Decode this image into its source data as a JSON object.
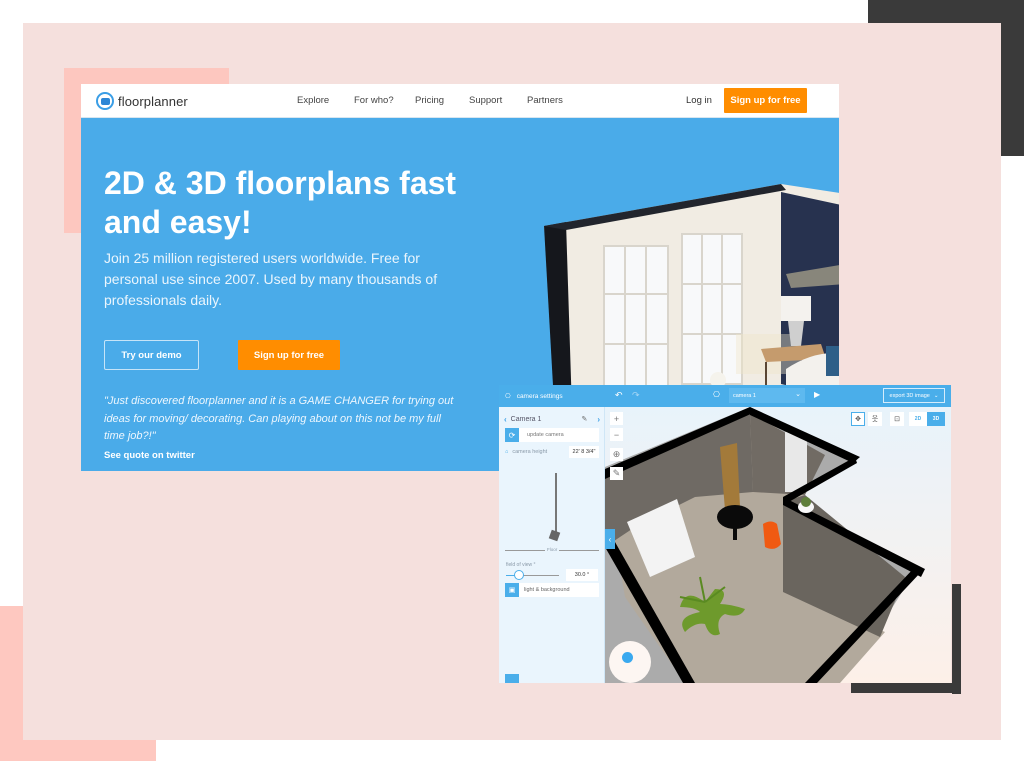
{
  "site": {
    "logo_text": "floorplanner",
    "nav": [
      "Explore",
      "For who?",
      "Pricing",
      "Support",
      "Partners"
    ],
    "login": "Log in",
    "signup_top": "Sign up for free",
    "hero_title": "2D & 3D floorplans fast and easy!",
    "hero_subtitle": "Join 25 million registered users worldwide. Free for personal use since 2007. Used by many thousands of professionals daily.",
    "demo_button": "Try our demo",
    "signup_button": "Sign up for free",
    "quote": "\"Just discovered floorplanner and it is a GAME CHANGER for trying out ideas for moving/ decorating. Can playing about on this not be my full time job?!\"",
    "quote_link": "See quote on twitter"
  },
  "app": {
    "panel_title": "camera settings",
    "camera_name": "Camera 1",
    "update_camera": "update camera",
    "camera_height_label": "camera height",
    "camera_height_value": "22' 8 3/4\"",
    "floor_label": "Floor",
    "fov_label": "field of view °",
    "fov_value": "30.0 °",
    "fov_fraction": 0.25,
    "light_background": "light & background",
    "camera_select": "camera 1",
    "export_button": "export 3D image",
    "mode_2d": "2D",
    "mode_3d": "3D",
    "active_mode": "3D"
  },
  "colors": {
    "brand_blue": "#4aabe9",
    "accent_orange": "#ff8d00",
    "bg_pink": "#f5e0dd",
    "coral": "#fdc7bf",
    "dark": "#3a3a3a"
  }
}
